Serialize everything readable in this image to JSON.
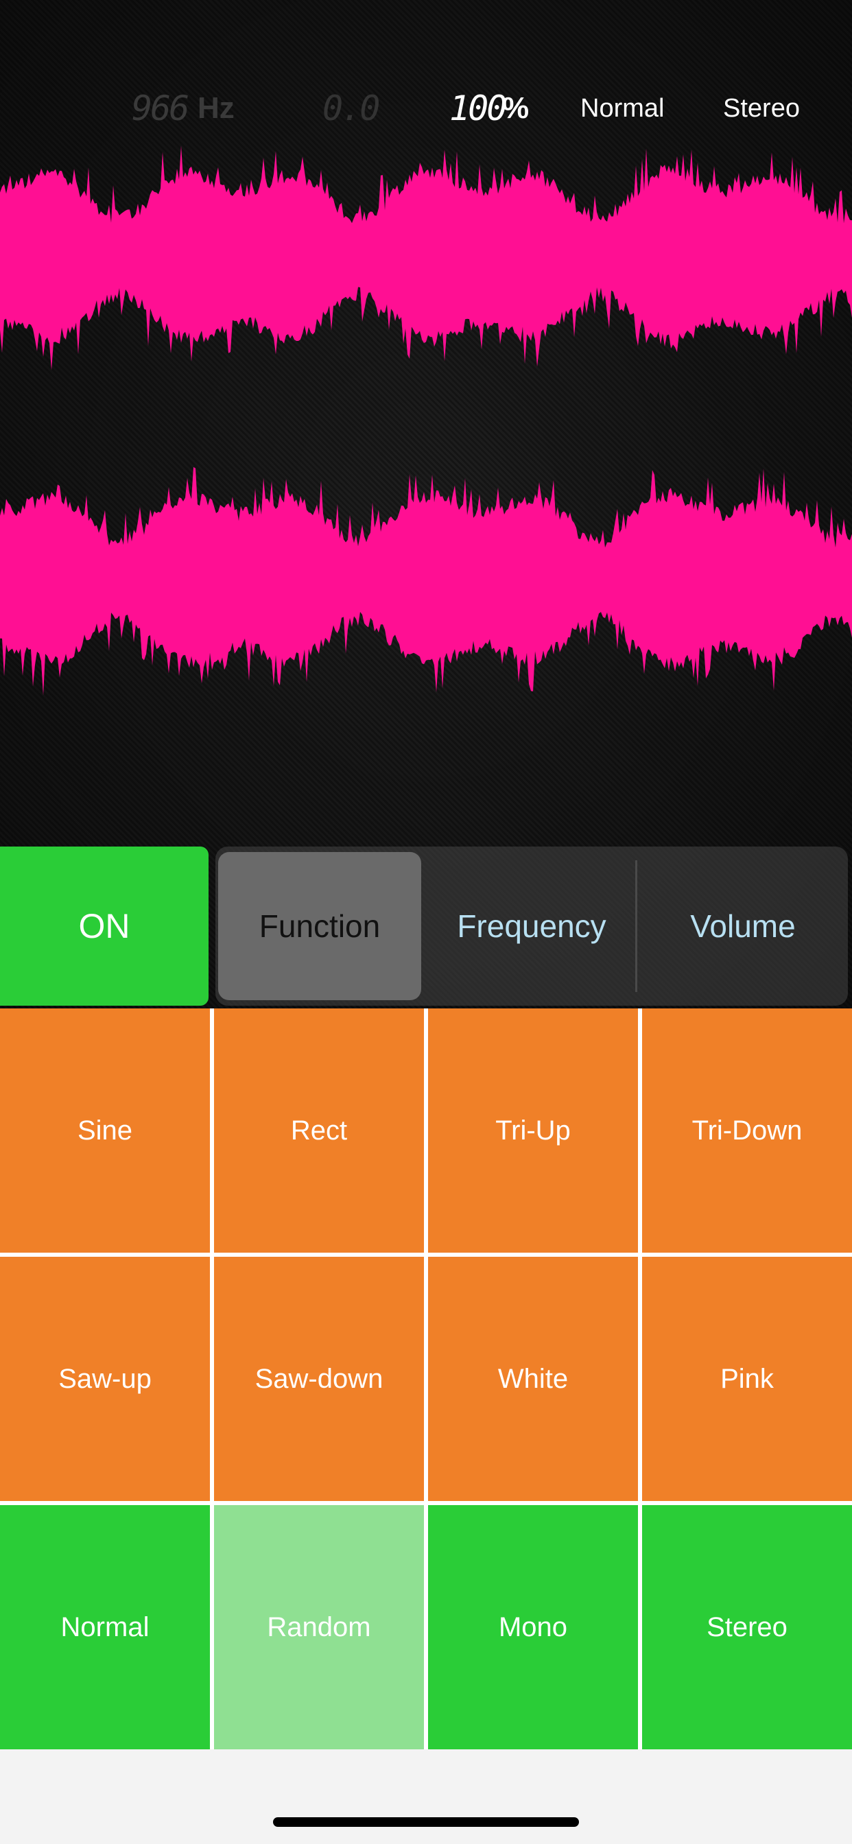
{
  "readouts": {
    "frequency_value": "966",
    "frequency_unit": "Hz",
    "phase_value": "0.0",
    "volume_value": "100",
    "volume_unit": "%",
    "mode": "Normal",
    "channel": "Stereo"
  },
  "waveform": {
    "color": "#ff0f93",
    "channels": 2
  },
  "controls": {
    "power_label": "ON",
    "tabs": [
      {
        "label": "Function",
        "selected": true
      },
      {
        "label": "Frequency",
        "selected": false
      },
      {
        "label": "Volume",
        "selected": false
      }
    ]
  },
  "grid": {
    "rows": [
      [
        "Sine",
        "Rect",
        "Tri-Up",
        "Tri-Down"
      ],
      [
        "Saw-up",
        "Saw-down",
        "White",
        "Pink"
      ],
      [
        "Normal",
        "Random",
        "Mono",
        "Stereo"
      ]
    ],
    "selected": "Random"
  },
  "colors": {
    "accent_green": "#2acd37",
    "accent_orange": "#f08028",
    "selected_green": "#8fe092",
    "wave_pink": "#ff0f93"
  }
}
